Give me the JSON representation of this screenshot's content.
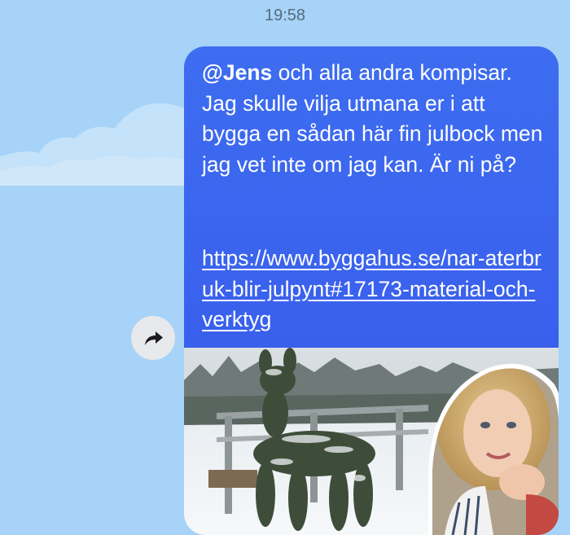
{
  "header": {
    "timestamp": "19:58"
  },
  "message": {
    "mention": "@Jens",
    "text": " och alla andra kompisar. Jag skulle vilja utmana er i att bygga en sådan här fin julbock men jag vet inte om jag kan. Är ni på?",
    "link": "https://www.byggahus.se/nar-aterbruk-blir-julpynt#17173-material-och-verktyg"
  },
  "icons": {
    "share": "share-arrow-icon"
  },
  "colors": {
    "background": "#a6d3f7",
    "bubble": "#3a62ee",
    "bubble_text": "#ffffff",
    "share_button": "#e7e9ec"
  }
}
